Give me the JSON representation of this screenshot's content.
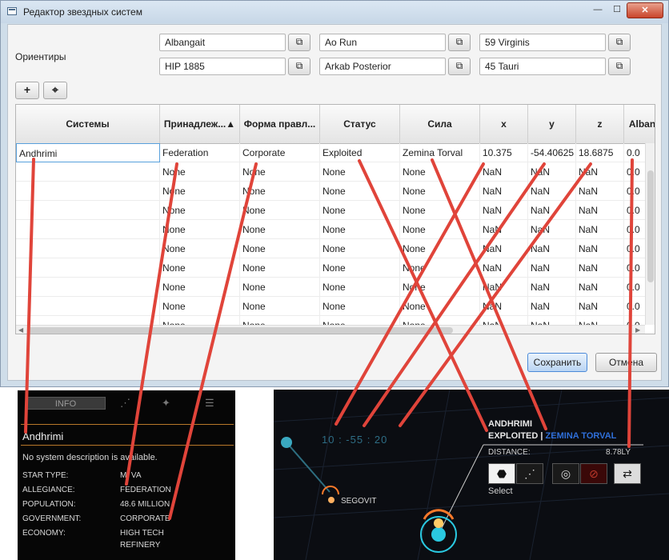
{
  "window": {
    "title": "Редактор звездных систем",
    "controls": {
      "minimize": "—",
      "maximize": "☐",
      "close": "✕"
    }
  },
  "landmarks": {
    "label": "Ориентиры",
    "fields": [
      "Albangait",
      "Ao Run",
      "59 Virginis",
      "HIP 1885",
      "Arkab Posterior",
      "45 Tauri"
    ],
    "copy_icon": "copy-icon"
  },
  "toolbar": {
    "add_label": "+",
    "locate_label": "⌖"
  },
  "table": {
    "columns": [
      "Системы",
      "Принадлеж...▲",
      "Форма правл...",
      "Статус",
      "Сила",
      "x",
      "y",
      "z",
      "Albanga"
    ],
    "rows": [
      [
        "Andhrimi",
        "Federation",
        "Corporate",
        "Exploited",
        "Zemina Torval",
        "10.375",
        "-54.40625",
        "18.6875",
        "0.0"
      ],
      [
        "",
        "None",
        "None",
        "None",
        "None",
        "NaN",
        "NaN",
        "NaN",
        "0.0"
      ],
      [
        "",
        "None",
        "None",
        "None",
        "None",
        "NaN",
        "NaN",
        "NaN",
        "0.0"
      ],
      [
        "",
        "None",
        "None",
        "None",
        "None",
        "NaN",
        "NaN",
        "NaN",
        "0.0"
      ],
      [
        "",
        "None",
        "None",
        "None",
        "None",
        "NaN",
        "NaN",
        "NaN",
        "0.0"
      ],
      [
        "",
        "None",
        "None",
        "None",
        "None",
        "NaN",
        "NaN",
        "NaN",
        "0.0"
      ],
      [
        "",
        "None",
        "None",
        "None",
        "None",
        "NaN",
        "NaN",
        "NaN",
        "0.0"
      ],
      [
        "",
        "None",
        "None",
        "None",
        "None",
        "NaN",
        "NaN",
        "NaN",
        "0.0"
      ],
      [
        "",
        "None",
        "None",
        "None",
        "None",
        "NaN",
        "NaN",
        "NaN",
        "0.0"
      ],
      [
        "",
        "None",
        "None",
        "None",
        "None",
        "NaN",
        "NaN",
        "NaN",
        "0.0"
      ]
    ]
  },
  "buttons": {
    "save": "Сохранить",
    "cancel": "Отмена"
  },
  "game_info": {
    "tab": "INFO",
    "system_name": "Andhrimi",
    "description": "No system description is available.",
    "entries": [
      {
        "key": "STAR TYPE:",
        "value": "M: VA"
      },
      {
        "key": "ALLEGIANCE:",
        "value": "FEDERATION"
      },
      {
        "key": "POPULATION:",
        "value": "48.6 MILLION"
      },
      {
        "key": "GOVERNMENT:",
        "value": "CORPORATE"
      },
      {
        "key": "ECONOMY:",
        "value": "HIGH TECH"
      },
      {
        "key": "",
        "value": "REFINERY"
      }
    ]
  },
  "game_map": {
    "coords": "10 : -55 : 20",
    "system_name": "ANDHRIMI",
    "status": "EXPLOITED",
    "separator": "|",
    "power": "ZEMINA TORVAL",
    "distance_label": "DISTANCE:",
    "distance_value": "8.78LY",
    "nearby_system": "SEGOVIT",
    "select_label": "Select",
    "power_color": "#2f6fd9"
  },
  "colors": {
    "annotation_lines": "#e0443a",
    "accent_orange": "#b8782a",
    "selection_blue": "#58a0dc"
  }
}
